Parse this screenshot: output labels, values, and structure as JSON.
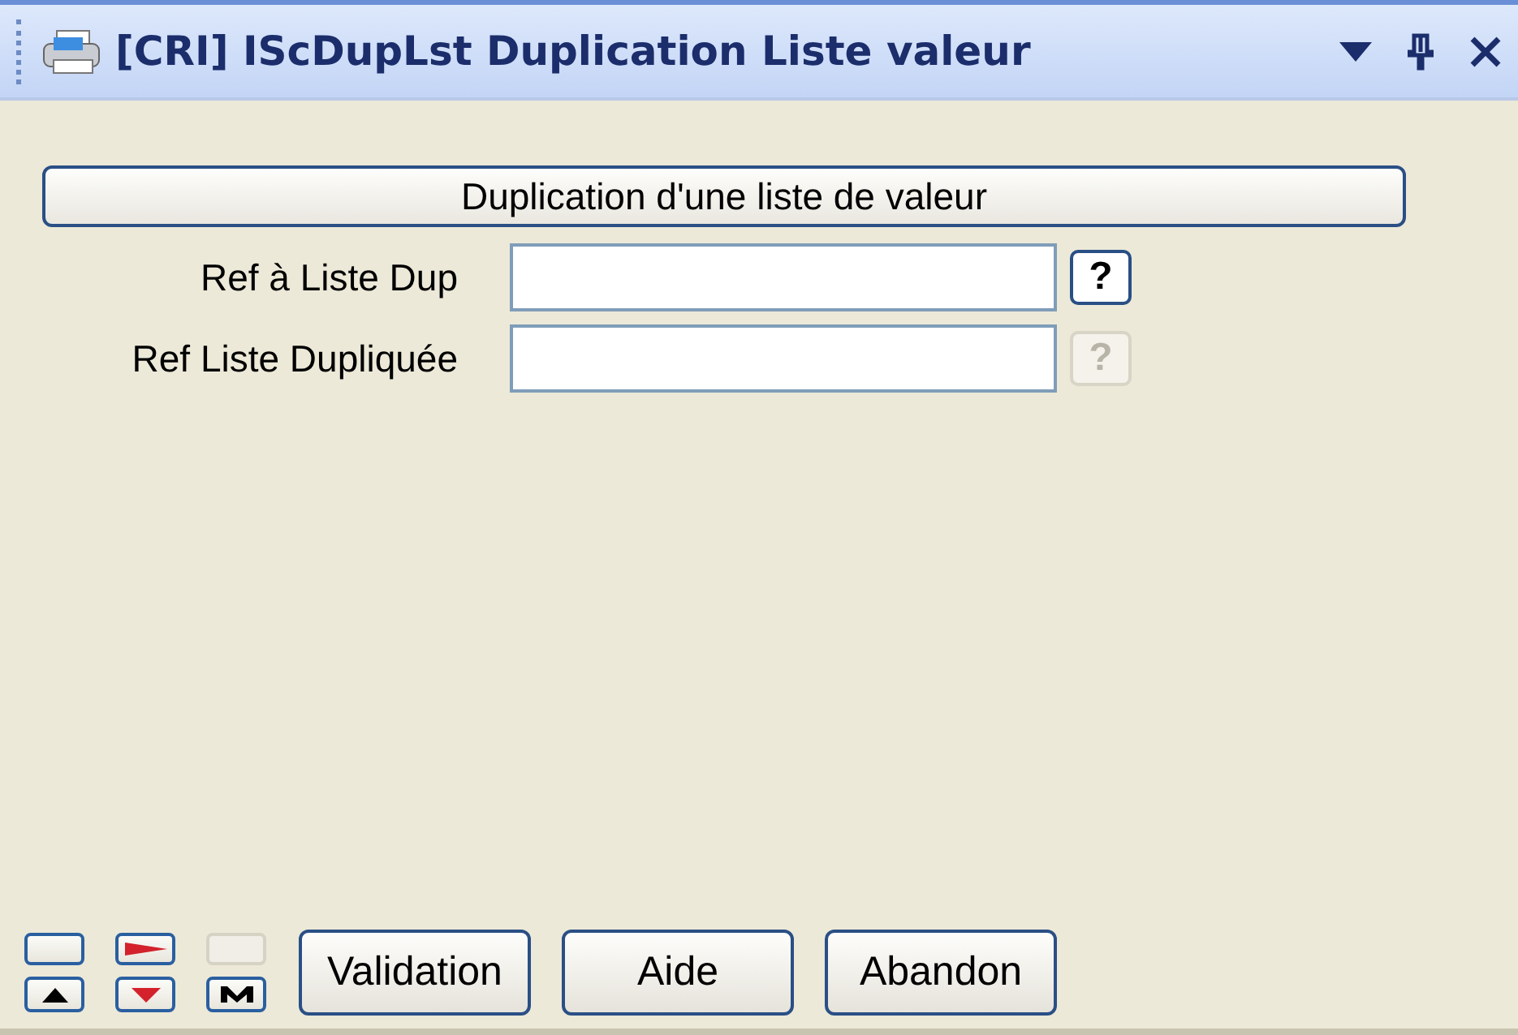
{
  "window": {
    "title": "[CRI] IScDupLst Duplication Liste valeur"
  },
  "header_button": {
    "label": "Duplication d'une liste de valeur"
  },
  "fields": [
    {
      "label": "Ref à Liste Dup",
      "help": "?",
      "disabled": false
    },
    {
      "label": "Ref Liste Dupliquée",
      "help": "?",
      "disabled": true
    }
  ],
  "nav_buttons": [
    {
      "kind": "blank",
      "disabled": false
    },
    {
      "kind": "next",
      "disabled": false
    },
    {
      "kind": "blank",
      "disabled": true
    },
    {
      "kind": "up",
      "disabled": false
    },
    {
      "kind": "down",
      "disabled": false
    },
    {
      "kind": "m",
      "disabled": false
    }
  ],
  "buttons": [
    "Validation",
    "Aide",
    "Abandon"
  ]
}
